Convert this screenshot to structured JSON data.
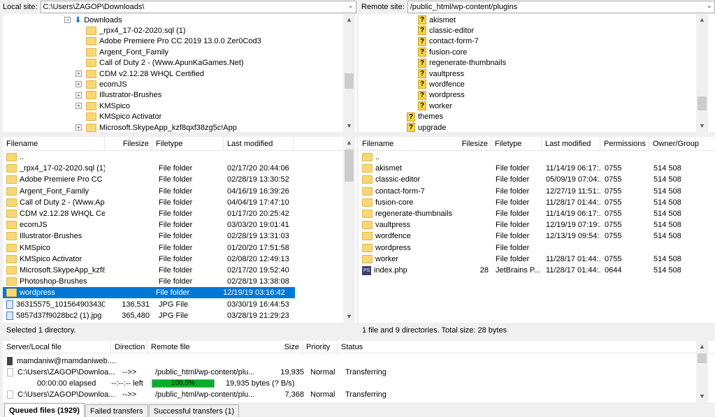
{
  "local_path": {
    "label": "Local site:",
    "value": "C:\\Users\\ZAGOP\\Downloads\\"
  },
  "remote_path": {
    "label": "Remote site:",
    "value": "/public_html/wp-content/plugins"
  },
  "local_tree": [
    {
      "label": "Downloads",
      "expander": "⊟"
    },
    {
      "label": "_rpx4_17-02-2020.sql (1)",
      "expander": ""
    },
    {
      "label": "Adobe Premiere Pro CC 2019 13.0.0 Zer0Cod3",
      "expander": ""
    },
    {
      "label": "Argent_Font_Family",
      "expander": ""
    },
    {
      "label": "Call of Duty 2 - (Www.ApunKaGames.Net)",
      "expander": ""
    },
    {
      "label": "CDM v2.12.28 WHQL Certified",
      "expander": "+"
    },
    {
      "label": "ecomJS",
      "expander": "+"
    },
    {
      "label": "Illustrator-Brushes",
      "expander": "+"
    },
    {
      "label": "KMSpico",
      "expander": "+"
    },
    {
      "label": "KMSpico Activator",
      "expander": ""
    },
    {
      "label": "Microsoft.SkypeApp_kzf8qxf38zg5c!App",
      "expander": "+"
    }
  ],
  "remote_tree": [
    {
      "label": "akismet",
      "indent": 2
    },
    {
      "label": "classic-editor",
      "indent": 2
    },
    {
      "label": "contact-form-7",
      "indent": 2
    },
    {
      "label": "fusion-core",
      "indent": 2
    },
    {
      "label": "regenerate-thumbnails",
      "indent": 2
    },
    {
      "label": "vaultpress",
      "indent": 2
    },
    {
      "label": "wordfence",
      "indent": 2
    },
    {
      "label": "wordpress",
      "indent": 2
    },
    {
      "label": "worker",
      "indent": 2
    },
    {
      "label": "themes",
      "indent": 1
    },
    {
      "label": "upgrade",
      "indent": 1
    }
  ],
  "local_columns": [
    "Filename",
    "Filesize",
    "Filetype",
    "Last modified"
  ],
  "local_files": [
    {
      "name": "..",
      "size": "",
      "type": "",
      "modified": "",
      "icon": "folder"
    },
    {
      "name": "_rpx4_17-02-2020.sql (1)",
      "size": "",
      "type": "File folder",
      "modified": "02/17/20 20:44:06",
      "icon": "folder"
    },
    {
      "name": "Adobe Premiere Pro CC 2...",
      "size": "",
      "type": "File folder",
      "modified": "02/28/19 13:30:52",
      "icon": "folder"
    },
    {
      "name": "Argent_Font_Family",
      "size": "",
      "type": "File folder",
      "modified": "04/16/19 16:39:26",
      "icon": "folder"
    },
    {
      "name": "Call of Duty 2 - (Www.Ap...",
      "size": "",
      "type": "File folder",
      "modified": "04/04/19 17:47:10",
      "icon": "folder"
    },
    {
      "name": "CDM v2.12.28 WHQL Cert...",
      "size": "",
      "type": "File folder",
      "modified": "01/17/20 20:25:42",
      "icon": "folder"
    },
    {
      "name": "ecomJS",
      "size": "",
      "type": "File folder",
      "modified": "03/03/20 19:01:41",
      "icon": "folder"
    },
    {
      "name": "Illustrator-Brushes",
      "size": "",
      "type": "File folder",
      "modified": "02/28/19 13:31:03",
      "icon": "folder"
    },
    {
      "name": "KMSpico",
      "size": "",
      "type": "File folder",
      "modified": "01/20/20 17:51:58",
      "icon": "folder"
    },
    {
      "name": "KMSpico Activator",
      "size": "",
      "type": "File folder",
      "modified": "02/08/20 12:49:13",
      "icon": "folder"
    },
    {
      "name": "Microsoft.SkypeApp_kzf8...",
      "size": "",
      "type": "File folder",
      "modified": "02/17/20 19:52:40",
      "icon": "folder"
    },
    {
      "name": "Photoshop-Brushes",
      "size": "",
      "type": "File folder",
      "modified": "02/28/19 13:38:08",
      "icon": "folder"
    },
    {
      "name": "wordpress",
      "size": "",
      "type": "File folder",
      "modified": "12/19/19 03:16:42",
      "icon": "folder",
      "selected": true
    },
    {
      "name": "36315575_10156490343052...",
      "size": "136,531",
      "type": "JPG File",
      "modified": "03/30/19 16:44:53",
      "icon": "jpg"
    },
    {
      "name": "5857d37f9028bc2 (1).jpg",
      "size": "365,480",
      "type": "JPG File",
      "modified": "03/28/19 21:29:23",
      "icon": "jpg"
    }
  ],
  "local_status": "Selected 1 directory.",
  "remote_columns": [
    "Filename",
    "Filesize",
    "Filetype",
    "Last modified",
    "Permissions",
    "Owner/Group"
  ],
  "remote_files": [
    {
      "name": "..",
      "size": "",
      "type": "",
      "modified": "",
      "perm": "",
      "owner": "",
      "icon": "folder"
    },
    {
      "name": "akismet",
      "size": "",
      "type": "File folder",
      "modified": "11/14/19 06:17:...",
      "perm": "0755",
      "owner": "514 508",
      "icon": "folder"
    },
    {
      "name": "classic-editor",
      "size": "",
      "type": "File folder",
      "modified": "05/09/19 07:04:...",
      "perm": "0755",
      "owner": "514 508",
      "icon": "folder"
    },
    {
      "name": "contact-form-7",
      "size": "",
      "type": "File folder",
      "modified": "12/27/19 11:51:...",
      "perm": "0755",
      "owner": "514 508",
      "icon": "folder"
    },
    {
      "name": "fusion-core",
      "size": "",
      "type": "File folder",
      "modified": "11/28/17 01:44:...",
      "perm": "0755",
      "owner": "514 508",
      "icon": "folder"
    },
    {
      "name": "regenerate-thumbnails",
      "size": "",
      "type": "File folder",
      "modified": "11/14/19 06:17:...",
      "perm": "0755",
      "owner": "514 508",
      "icon": "folder"
    },
    {
      "name": "vaultpress",
      "size": "",
      "type": "File folder",
      "modified": "12/19/19 07:19:...",
      "perm": "0755",
      "owner": "514 508",
      "icon": "folder"
    },
    {
      "name": "wordfence",
      "size": "",
      "type": "File folder",
      "modified": "12/13/19 09:54:...",
      "perm": "0755",
      "owner": "514 508",
      "icon": "folder"
    },
    {
      "name": "wordpress",
      "size": "",
      "type": "File folder",
      "modified": "",
      "perm": "",
      "owner": "",
      "icon": "folder"
    },
    {
      "name": "worker",
      "size": "",
      "type": "File folder",
      "modified": "11/28/17 01:44:...",
      "perm": "0755",
      "owner": "514 508",
      "icon": "folder"
    },
    {
      "name": "index.php",
      "size": "28",
      "type": "JetBrains P...",
      "modified": "11/28/17 01:44:...",
      "perm": "0644",
      "owner": "514 508",
      "icon": "php"
    }
  ],
  "remote_status": "1 file and 9 directories. Total size: 28 bytes",
  "queue_columns": [
    "Server/Local file",
    "Direction",
    "Remote file",
    "Size",
    "Priority",
    "Status"
  ],
  "queue": {
    "server": "mamdaniw@mamdaniweb....",
    "rows": [
      {
        "local": "C:\\Users\\ZAGOP\\Downloa...",
        "direction": "-->>",
        "remote": "/public_html/wp-content/plu...",
        "size": "19,935",
        "priority": "Normal",
        "status": "Transferring"
      },
      {
        "local": "C:\\Users\\ZAGOP\\Downloa...",
        "direction": "-->>",
        "remote": "/public_html/wp-content/plu...",
        "size": "7,368",
        "priority": "Normal",
        "status": "Transferring"
      }
    ],
    "progress": {
      "elapsed": "00:00:00 elapsed",
      "left": "--:--:-- left",
      "percent_label": "100.0%",
      "percent": 100,
      "bytes": "19,935 bytes (? B/s)"
    }
  },
  "tabs": [
    "Queued files (1929)",
    "Failed transfers",
    "Successful transfers (1)"
  ],
  "colors": {
    "selection": "#0078d7",
    "folder": "#f8d775",
    "progress": "#06b025"
  }
}
